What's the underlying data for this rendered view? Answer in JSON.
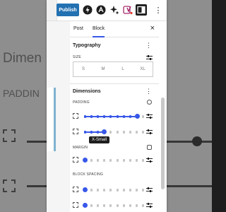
{
  "background": {
    "title_fragment": "Dimen",
    "padding_fragment": "PADDIN"
  },
  "toolbar": {
    "publish_label": "Publish",
    "icons": [
      "jetpack-icon",
      "ai-icon",
      "sparkle-icon",
      "yoast-icon",
      "sidebar-toggle-icon",
      "more-vertical-icon"
    ]
  },
  "panel": {
    "tabs": [
      {
        "label": "Post"
      },
      {
        "label": "Block"
      }
    ],
    "active_tab": "Block",
    "typography": {
      "title": "Typography",
      "size_label": "SIZE",
      "sizes": [
        "S",
        "M",
        "L",
        "XL"
      ]
    },
    "dimensions": {
      "title": "Dimensions",
      "padding_label": "PADDING",
      "margin_label": "MARGIN",
      "block_spacing_label": "BLOCK SPACING",
      "tooltip": "X-Small",
      "sliders": {
        "padding_top": {
          "value_fraction": 0.9
        },
        "padding_bottom": {
          "value_fraction": 0.33
        },
        "margin": {
          "value_fraction": 0.0
        },
        "block_spacing_1": {
          "value_fraction": 0.0
        },
        "block_spacing_2": {
          "value_fraction": 0.0
        }
      }
    }
  },
  "colors": {
    "accent": "#3858e9",
    "publish": "#2271b1"
  }
}
